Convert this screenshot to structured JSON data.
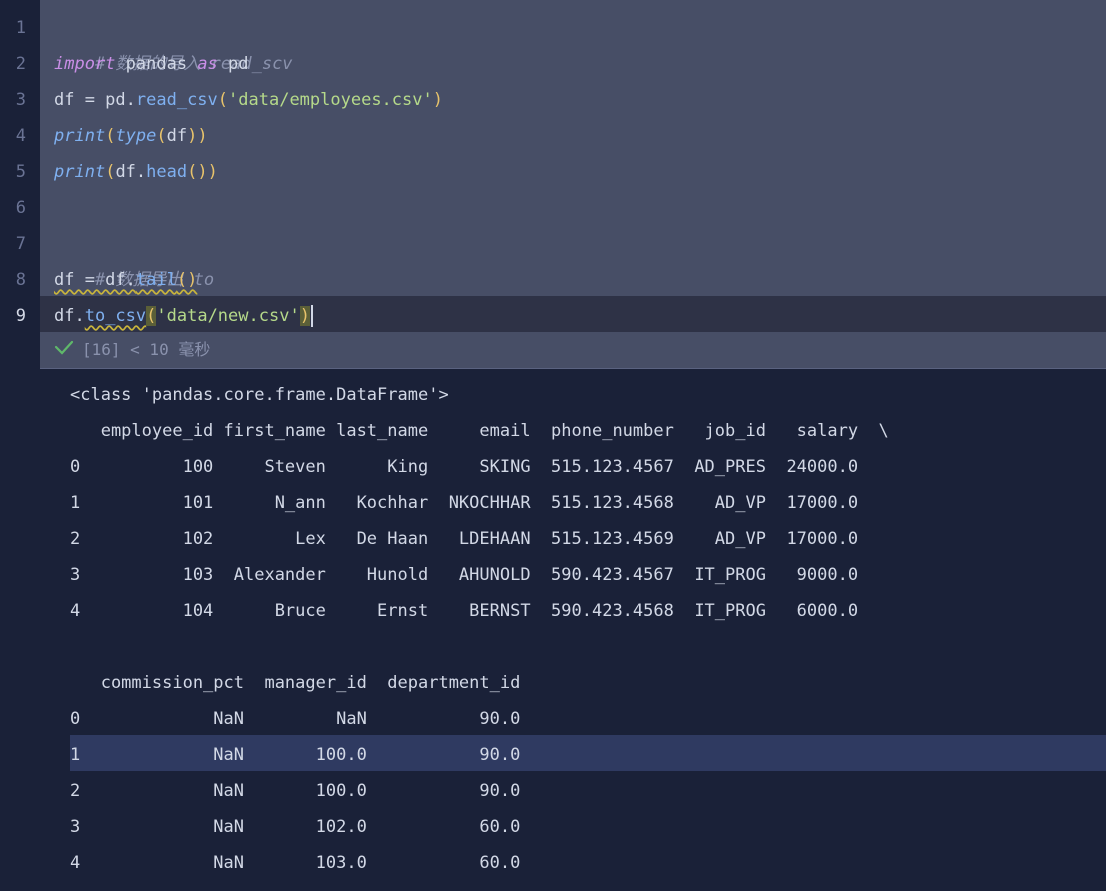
{
  "editor": {
    "line_numbers": [
      "1",
      "2",
      "3",
      "4",
      "5",
      "6",
      "7",
      "8",
      "9"
    ],
    "current_line": "9",
    "lines": {
      "l1_comment": "# 数据的导入 read_scv",
      "l2_import": "import",
      "l2_pandas": " pandas ",
      "l2_as": "as",
      "l2_pd": " pd",
      "l3_a": "df = pd.",
      "l3_fn": "read_csv",
      "l3_p1": "(",
      "l3_str": "'data/employees.csv'",
      "l3_p2": ")",
      "l4_fn": "print",
      "l4_p1": "(",
      "l4_fn2": "type",
      "l4_p2": "(",
      "l4_arg": "df",
      "l4_p3": "))",
      "l5_fn": "print",
      "l5_p1": "(",
      "l5_a": "df.",
      "l5_fn2": "head",
      "l5_p2": "())",
      "l7_comment": "# 数据导出 to",
      "l8_a": "df = df.",
      "l8_fn": "tail",
      "l8_p": "()",
      "l9_a": "df.",
      "l9_fn": "to_csv",
      "l9_p1": "(",
      "l9_str": "'data/new.csv'",
      "l9_p2": ")"
    },
    "status": "[16] < 10 毫秒"
  },
  "output": {
    "lines": [
      "<class 'pandas.core.frame.DataFrame'>",
      "   employee_id first_name last_name     email  phone_number   job_id   salary  \\",
      "0          100     Steven      King     SKING  515.123.4567  AD_PRES  24000.0",
      "1          101      N_ann   Kochhar  NKOCHHAR  515.123.4568    AD_VP  17000.0",
      "2          102        Lex   De Haan   LDEHAAN  515.123.4569    AD_VP  17000.0",
      "3          103  Alexander    Hunold   AHUNOLD  590.423.4567  IT_PROG   9000.0",
      "4          104      Bruce     Ernst    BERNST  590.423.4568  IT_PROG   6000.0",
      "",
      "   commission_pct  manager_id  department_id",
      "0             NaN         NaN           90.0",
      "1             NaN       100.0           90.0",
      "2             NaN       100.0           90.0",
      "3             NaN       102.0           60.0",
      "4             NaN       103.0           60.0"
    ],
    "highlighted_row_index": 10
  },
  "colors": {
    "cell_bg": "#474e66",
    "output_bg": "#1a2138",
    "highlight": "#2f3a61"
  }
}
